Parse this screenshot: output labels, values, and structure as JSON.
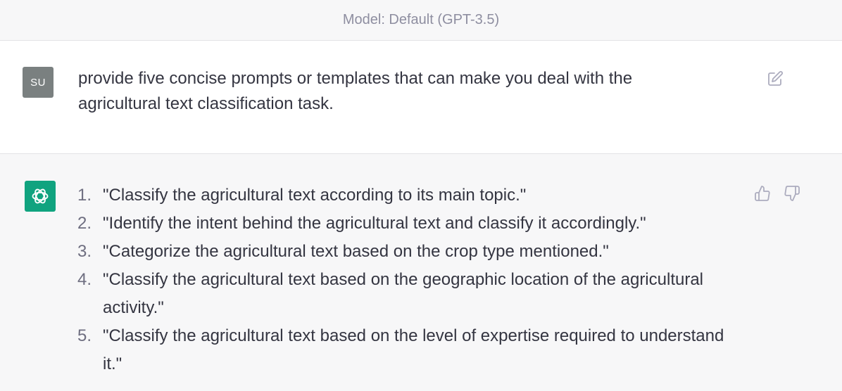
{
  "header": {
    "model_label": "Model: Default (GPT-3.5)"
  },
  "user_message": {
    "avatar_initials": "SU",
    "text": "provide five concise prompts or templates that can make you deal with the agricultural text classification task.",
    "edit_icon": "edit-icon"
  },
  "assistant_message": {
    "avatar_icon": "openai-logo-icon",
    "items": [
      {
        "number": "1.",
        "text": "\"Classify the agricultural text according to its main topic.\""
      },
      {
        "number": "2.",
        "text": "\"Identify the intent behind the agricultural text and classify it accordingly.\""
      },
      {
        "number": "3.",
        "text": "\"Categorize the agricultural text based on the crop type mentioned.\""
      },
      {
        "number": "4.",
        "text": "\"Classify the agricultural text based on the geographic location of the agricultural activity.\""
      },
      {
        "number": "5.",
        "text": "\"Classify the agricultural text based on the level of expertise required to understand it.\""
      }
    ],
    "feedback_icons": [
      "thumbs-up-icon",
      "thumbs-down-icon"
    ]
  },
  "colors": {
    "brand_green": "#10a37f",
    "user_avatar": "#7a8080",
    "text": "#343541",
    "muted": "#8e8ea0"
  }
}
